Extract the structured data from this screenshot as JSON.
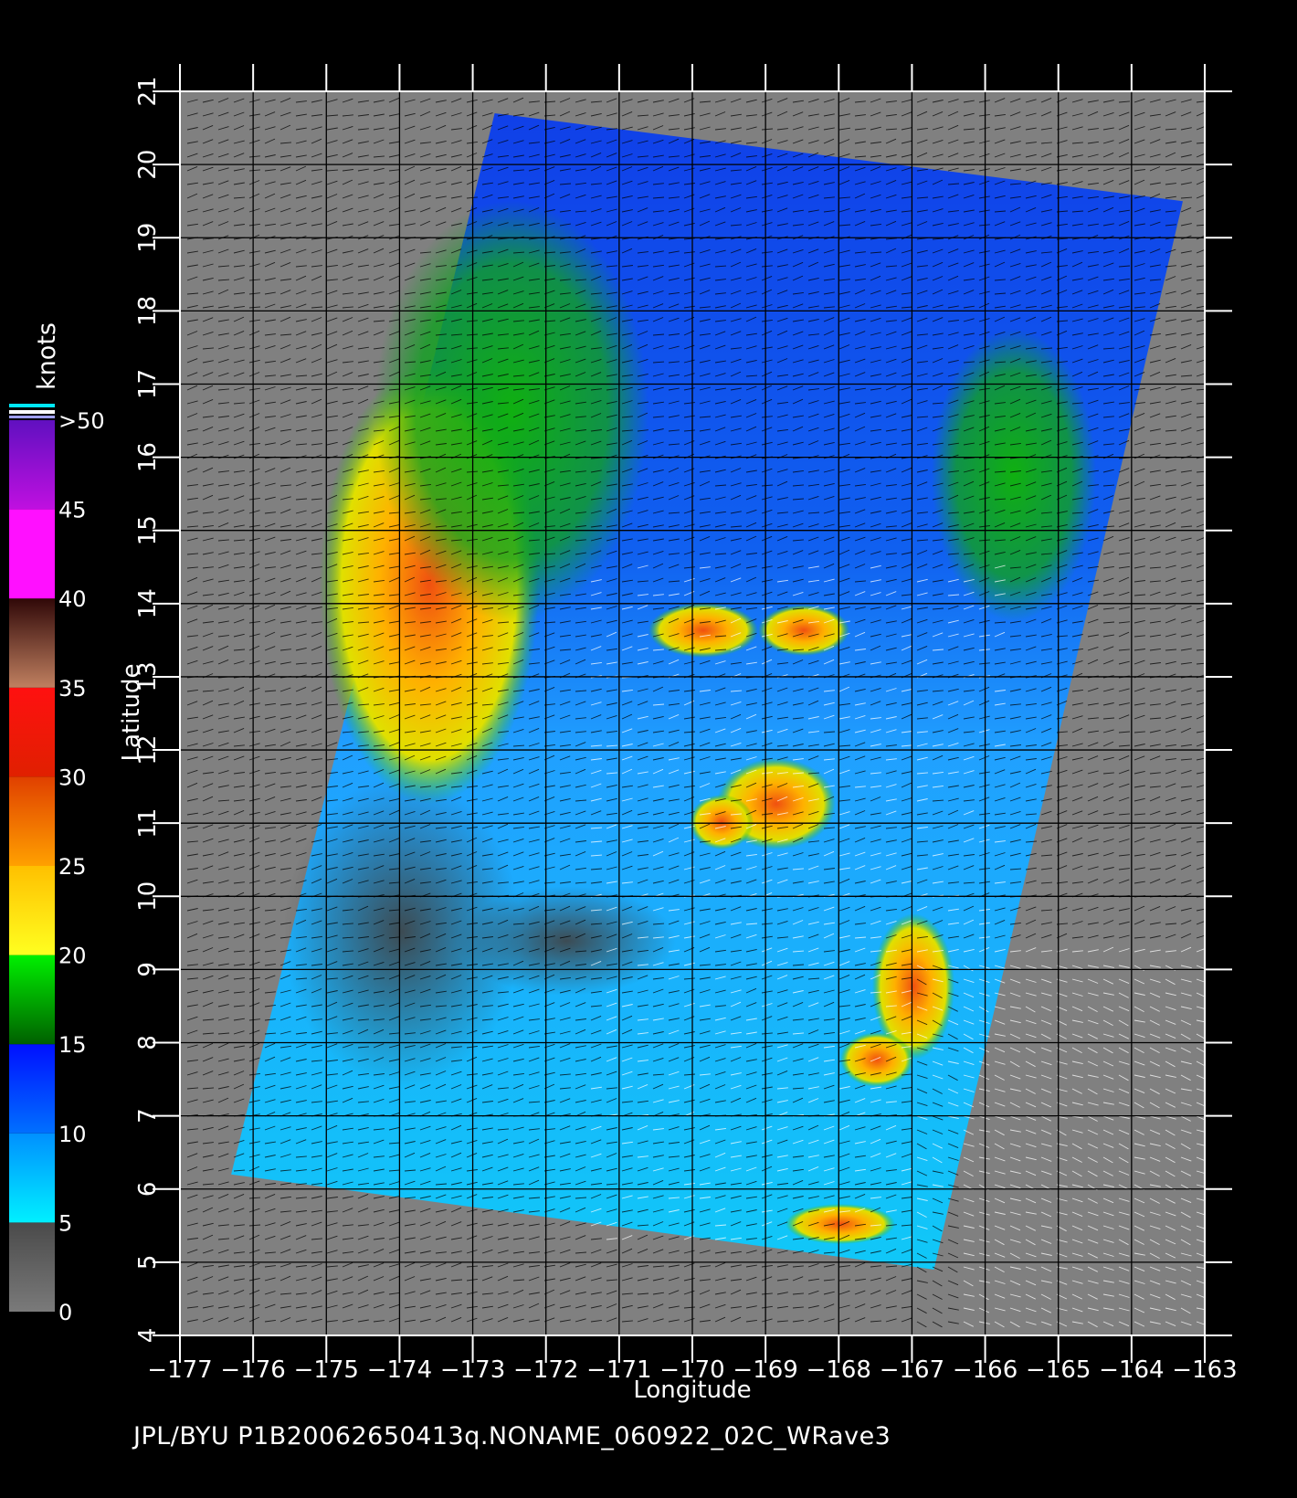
{
  "map": {
    "x_axis_label": "Longitude",
    "y_axis_label": "Latitude",
    "x_range": [
      -177,
      -163
    ],
    "y_range": [
      4,
      21
    ],
    "lon_ticks": [
      "−177",
      "−176",
      "−175",
      "−174",
      "−173",
      "−172",
      "−171",
      "−170",
      "−169",
      "−168",
      "−167",
      "−166",
      "−165",
      "−164",
      "−163"
    ],
    "lat_ticks": [
      "4",
      "5",
      "6",
      "7",
      "8",
      "9",
      "10",
      "11",
      "12",
      "13",
      "14",
      "15",
      "16",
      "17",
      "18",
      "19",
      "20",
      "21"
    ],
    "swath_corners": [
      {
        "lon": -172.7,
        "lat": 20.7
      },
      {
        "lon": -163.3,
        "lat": 19.5
      },
      {
        "lon": -166.7,
        "lat": 4.9
      },
      {
        "lon": -176.3,
        "lat": 6.2
      }
    ],
    "land_fill_color": "#808080",
    "grid_color": "#000000"
  },
  "colorbar": {
    "title": "knots",
    "labels": [
      "0",
      "5",
      "10",
      "15",
      "20",
      "25",
      "30",
      "35",
      "40",
      "45",
      ">50"
    ],
    "bands": [
      {
        "from": 0,
        "to": 5,
        "top": "#4a4a4a",
        "bottom": "#7a7a7a"
      },
      {
        "from": 5,
        "to": 10,
        "top": "#0090ff",
        "bottom": "#00f0ff"
      },
      {
        "from": 10,
        "to": 15,
        "top": "#0010ff",
        "bottom": "#0070ff"
      },
      {
        "from": 15,
        "to": 20,
        "top": "#00f000",
        "bottom": "#006000"
      },
      {
        "from": 20,
        "to": 25,
        "top": "#ffc000",
        "bottom": "#ffff20"
      },
      {
        "from": 25,
        "to": 30,
        "top": "#e04000",
        "bottom": "#ffa000"
      },
      {
        "from": 30,
        "to": 35,
        "top": "#ff1010",
        "bottom": "#e02000"
      },
      {
        "from": 35,
        "to": 40,
        "top": "#300808",
        "bottom": "#c08060"
      },
      {
        "from": 40,
        "to": 45,
        "top": "#ff10ff",
        "bottom": "#ff10ff"
      },
      {
        "from": 45,
        "to": 50,
        "top": "#6010c0",
        "bottom": "#c010e0"
      }
    ]
  },
  "footer": {
    "text": "JPL/BYU  P1B20062650413q.NONAME_060922_02C_WRave3"
  }
}
